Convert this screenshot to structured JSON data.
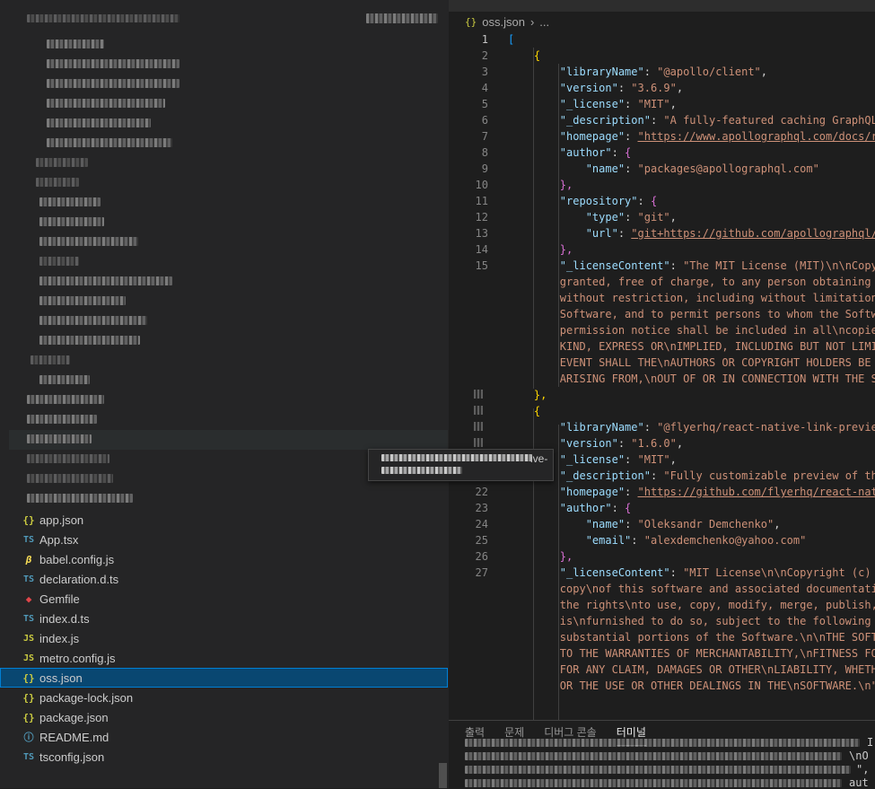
{
  "colors": {
    "selection": "#094771",
    "json_icon": "#cbcb41",
    "ts_icon": "#519aba",
    "string": "#ce9178",
    "key": "#9cdcfe"
  },
  "sidebar": {
    "files": [
      {
        "icon": "{}",
        "icon_name": "json-icon",
        "label": "app.json"
      },
      {
        "icon": "TS",
        "icon_name": "typescript-icon",
        "label": "App.tsx"
      },
      {
        "icon": "β",
        "icon_name": "babel-icon",
        "label": "babel.config.js"
      },
      {
        "icon": "TS",
        "icon_name": "typescript-icon",
        "label": "declaration.d.ts"
      },
      {
        "icon": "◆",
        "icon_name": "ruby-icon",
        "label": "Gemfile"
      },
      {
        "icon": "TS",
        "icon_name": "typescript-icon",
        "label": "index.d.ts"
      },
      {
        "icon": "JS",
        "icon_name": "javascript-icon",
        "label": "index.js"
      },
      {
        "icon": "JS",
        "icon_name": "javascript-icon",
        "label": "metro.config.js"
      },
      {
        "icon": "{}",
        "icon_name": "json-icon",
        "label": "oss.json",
        "selected": true
      },
      {
        "icon": "{}",
        "icon_name": "json-icon",
        "label": "package-lock.json"
      },
      {
        "icon": "{}",
        "icon_name": "json-icon",
        "label": "package.json"
      },
      {
        "icon": "ⓘ",
        "icon_name": "info-icon",
        "label": "README.md"
      },
      {
        "icon": "TS",
        "icon_name": "typescript-icon",
        "label": "tsconfig.json"
      }
    ]
  },
  "tooltip": {
    "visible_suffix": "ive-"
  },
  "editor": {
    "breadcrumb": {
      "icon": "{}",
      "file": "oss.json",
      "separator": "›",
      "more": "..."
    },
    "line_numbers": [
      "1",
      "2",
      "3",
      "4",
      "5",
      "6",
      "7",
      "8",
      "9",
      "10",
      "11",
      "12",
      "13",
      "14",
      "15",
      "22",
      "23",
      "24",
      "25",
      "26",
      "27"
    ],
    "code": {
      "l1": "[",
      "l2": "{",
      "lib1_key": "\"libraryName\"",
      "lib1_val": "\"@apollo/client\"",
      "ver1_key": "\"version\"",
      "ver1_val": "\"3.6.9\"",
      "lic1_key": "\"_license\"",
      "lic1_val": "\"MIT\"",
      "desc1_key": "\"_description\"",
      "desc1_val": "\"A fully-featured caching GraphQL",
      "home1_key": "\"homepage\"",
      "home1_val": "\"https://www.apollographql.com/docs/r",
      "auth1_key": "\"author\"",
      "auth1_open": "{",
      "name1_key": "\"name\"",
      "name1_val": "\"packages@apollographql.com\"",
      "auth1_close": "},",
      "repo1_key": "\"repository\"",
      "repo1_open": "{",
      "type1_key": "\"type\"",
      "type1_val": "\"git\"",
      "url1_key": "\"url\"",
      "url1_val": "\"git+https://github.com/apollographql/",
      "repo1_close": "},",
      "lc1_key": "\"_licenseContent\"",
      "lc1_val": "\"The MIT License (MIT)\\n\\nCopy",
      "lc1_w1": "granted, free of charge, to any person obtaining",
      "lc1_w2": "without restriction, including without limitation",
      "lc1_w3": "Software, and to permit persons to whom the Softw",
      "lc1_w4": "permission notice shall be included in all\\ncopie",
      "lc1_w5": "KIND, EXPRESS OR\\nIMPLIED, INCLUDING BUT NOT LIMI",
      "lc1_w6": "EVENT SHALL THE\\nAUTHORS OR COPYRIGHT HOLDERS BE",
      "lc1_w7": "ARISING FROM,\\nOUT OF OR IN CONNECTION WITH THE S",
      "obj1_close": "},",
      "obj2_open": "{",
      "lib2_key": "\"libraryName\"",
      "lib2_val": "\"@flyerhq/react-native-link-previe",
      "ver2_key": "\"version\"",
      "ver2_val": "\"1.6.0\"",
      "lic2_key": "\"_license\"",
      "lic2_val": "\"MIT\"",
      "desc2_key": "\"_description\"",
      "desc2_val": "\"Fully customizable preview of th",
      "home2_key": "\"homepage\"",
      "home2_val": "\"https://github.com/flyerhq/react-nat",
      "auth2_key": "\"author\"",
      "auth2_open": "{",
      "name2_key": "\"name\"",
      "name2_val": "\"Oleksandr Demchenko\"",
      "email2_key": "\"email\"",
      "email2_val": "\"alexdemchenko@yahoo.com\"",
      "auth2_close": "},",
      "lc2_key": "\"_licenseContent\"",
      "lc2_val": "\"MIT License\\n\\nCopyright (c)",
      "lc2_w1": "copy\\nof this software and associated documentati",
      "lc2_w2": "the rights\\nto use, copy, modify, merge, publish,",
      "lc2_w3": "is\\nfurnished to do so, subject to the following",
      "lc2_w4": "substantial portions of the Software.\\n\\nTHE SOFT",
      "lc2_w5": "TO THE WARRANTIES OF MERCHANTABILITY,\\nFITNESS FO",
      "lc2_w6": "FOR ANY CLAIM, DAMAGES OR OTHER\\nLIABILITY, WHETH",
      "lc2_w7": "OR THE USE OR OTHER DEALINGS IN THE\\nSOFTWARE.\\n\""
    }
  },
  "panel": {
    "tabs": [
      {
        "label": "출력",
        "active": false
      },
      {
        "label": "문제",
        "active": false
      },
      {
        "label": "디버그 콘솔",
        "active": false
      },
      {
        "label": "터미널",
        "active": true
      }
    ],
    "terminal_fragments": {
      "f1": "I",
      "f2": "\\nO",
      "f3": "\",",
      "f4": "aut"
    }
  }
}
